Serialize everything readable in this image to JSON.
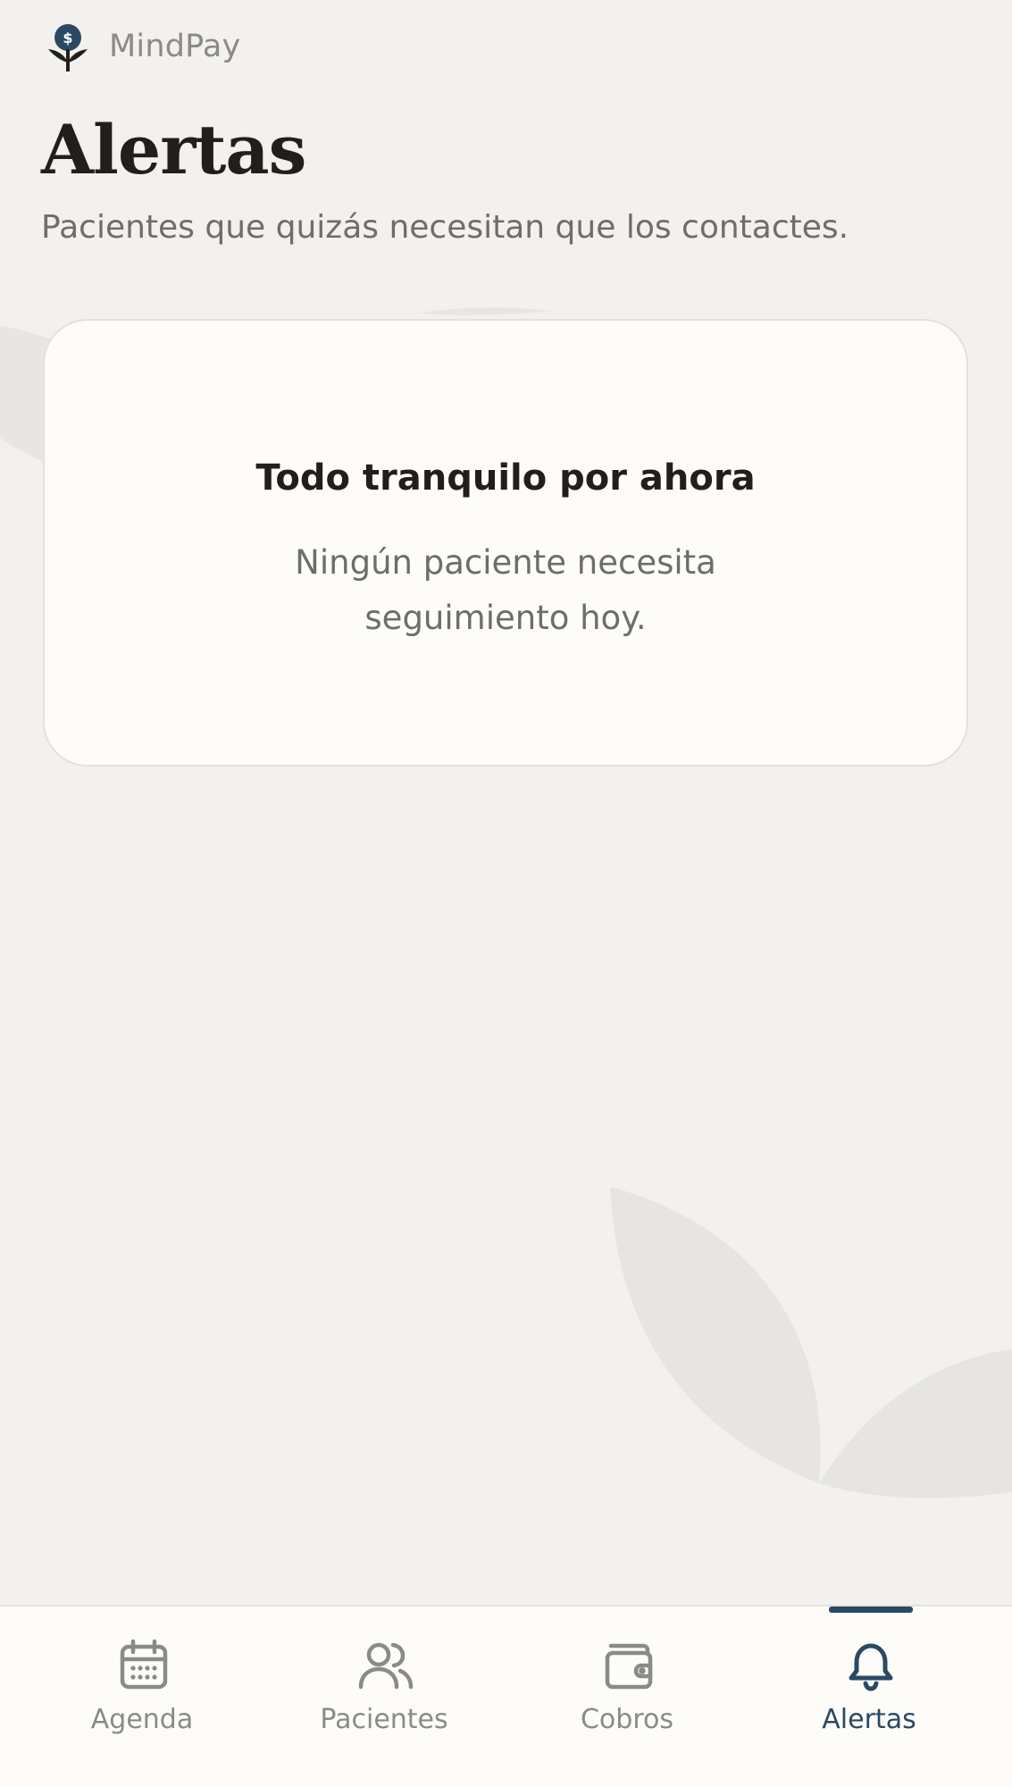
{
  "app": {
    "name": "MindPay",
    "logo_icon": "flower-dollar-icon"
  },
  "page": {
    "title": "Alertas",
    "subtitle": "Pacientes que quizás necesitan que los contactes."
  },
  "empty_state": {
    "title": "Todo tranquilo por ahora",
    "message": "Ningún paciente necesita seguimiento hoy."
  },
  "bottom_nav": {
    "active": "Alertas",
    "items": [
      {
        "label": "Agenda",
        "icon": "calendar-icon"
      },
      {
        "label": "Pacientes",
        "icon": "users-icon"
      },
      {
        "label": "Cobros",
        "icon": "wallet-icon"
      },
      {
        "label": "Alertas",
        "icon": "bell-icon"
      }
    ]
  },
  "colors": {
    "background": "#f3f1ed",
    "card": "#fdfcf9",
    "accent": "#2a4a64",
    "text_primary": "#221f1b",
    "text_secondary": "#6f6d69",
    "nav_inactive": "#8b8a86"
  }
}
